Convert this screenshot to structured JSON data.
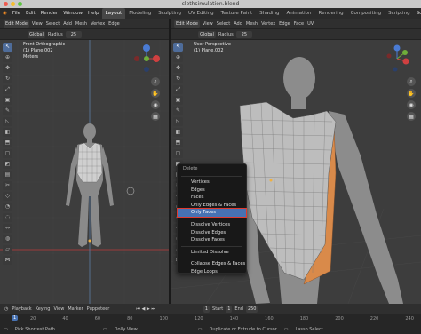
{
  "window": {
    "title": "clothsimulation.blend"
  },
  "menubar": {
    "items": [
      "File",
      "Edit",
      "Render",
      "Window",
      "Help"
    ],
    "workspaces": [
      "Layout",
      "Modeling",
      "Sculpting",
      "UV Editing",
      "Texture Paint",
      "Shading",
      "Animation",
      "Rendering",
      "Compositing",
      "Scripting"
    ],
    "scene_label": "Scene"
  },
  "left_viewport": {
    "header": {
      "mode": "Edit Mode",
      "view": "View",
      "select": "Select",
      "add": "Add",
      "mesh": "Mesh",
      "vertex": "Vertex",
      "edge": "Edge",
      "orientation": "Global",
      "radius_label": "Radius",
      "radius_value": "25"
    },
    "info": {
      "line1": "Front Orthographic",
      "line2": "(1) Plane.002",
      "line3": "Meters"
    }
  },
  "right_viewport": {
    "header": {
      "mode": "Edit Mode",
      "view": "View",
      "select": "Select",
      "add": "Add",
      "mesh": "Mesh",
      "vertex": "Vertex",
      "edge": "Edge",
      "face": "Face",
      "uv": "UV",
      "orientation": "Global",
      "radius_label": "Radius",
      "radius_value": "25"
    },
    "info": {
      "line1": "User Perspective",
      "line2": "(1) Plane.002"
    }
  },
  "context_menu": {
    "title": "Delete",
    "items": [
      "Vertices",
      "Edges",
      "Faces",
      "Only Edges & Faces",
      "Only Faces",
      "Dissolve Vertices",
      "Dissolve Edges",
      "Dissolve Faces",
      "Limited Dissolve",
      "Collapse Edges & Faces",
      "Edge Loops"
    ],
    "highlighted": "Only Faces",
    "highlight_color": "#4772b3",
    "marker_color": "#e03a2e"
  },
  "timeline": {
    "menus": [
      "Playback",
      "Keying",
      "View",
      "Marker",
      "Puppeteer"
    ],
    "frame_current": "1",
    "start_label": "Start",
    "start_value": "1",
    "end_label": "End",
    "end_value": "250",
    "ruler": [
      "20",
      "40",
      "60",
      "80",
      "100",
      "120",
      "140",
      "160",
      "180",
      "200",
      "220",
      "240"
    ]
  },
  "statusbar": {
    "items": [
      "Pick Shortest Path",
      "Dolly View",
      "Duplicate or Extrude to Cursor",
      "Lasso Select"
    ]
  },
  "colors": {
    "mesh_face": "#bdbdbd",
    "cloth_back": "#d98a4a",
    "accent": "#4772b3"
  }
}
